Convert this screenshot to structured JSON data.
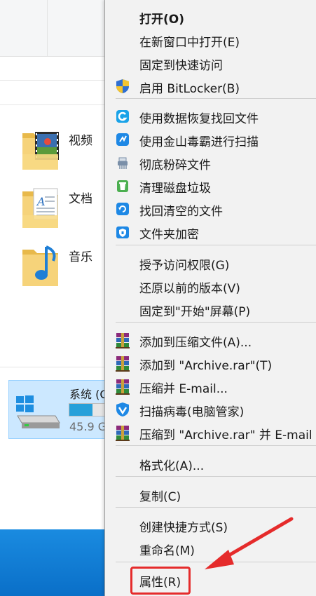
{
  "explorer": {
    "folders": [
      {
        "name": "视频",
        "icon": "video-folder-icon"
      },
      {
        "name": "文档",
        "icon": "documents-folder-icon"
      },
      {
        "name": "音乐",
        "icon": "music-folder-icon"
      }
    ],
    "drive": {
      "name": "系统 (C",
      "free_text": "45.9 G",
      "usage_fraction": 0.55
    }
  },
  "menu": {
    "items": [
      {
        "label": "打开(O)",
        "bold": true,
        "icon": ""
      },
      {
        "label": "在新窗口中打开(E)",
        "icon": ""
      },
      {
        "label": "固定到快速访问",
        "icon": ""
      },
      {
        "label": "启用 BitLocker(B)",
        "icon": "shield-icon"
      },
      {
        "label": "使用数据恢复找回文件",
        "icon": "data-recovery-icon"
      },
      {
        "label": "使用金山毒霸进行扫描",
        "icon": "antivirus-scan-icon"
      },
      {
        "label": "彻底粉碎文件",
        "icon": "shredder-icon"
      },
      {
        "label": "清理磁盘垃圾",
        "icon": "trash-clean-icon"
      },
      {
        "label": "找回清空的文件",
        "icon": "restore-icon"
      },
      {
        "label": "文件夹加密",
        "icon": "folder-lock-icon"
      },
      {
        "label": "授予访问权限(G)",
        "icon": ""
      },
      {
        "label": "还原以前的版本(V)",
        "icon": ""
      },
      {
        "label": "固定到\"开始\"屏幕(P)",
        "icon": ""
      },
      {
        "label": "添加到压缩文件(A)...",
        "icon": "winrar-icon"
      },
      {
        "label": "添加到 \"Archive.rar\"(T)",
        "icon": "winrar-icon"
      },
      {
        "label": "压缩并 E-mail...",
        "icon": "winrar-icon"
      },
      {
        "label": "扫描病毒(电脑管家)",
        "icon": "tencent-guard-icon"
      },
      {
        "label": "压缩到 \"Archive.rar\" 并 E-mail",
        "icon": "winrar-icon"
      },
      {
        "label": "格式化(A)...",
        "icon": ""
      },
      {
        "label": "复制(C)",
        "icon": ""
      },
      {
        "label": "创建快捷方式(S)",
        "icon": ""
      },
      {
        "label": "重命名(M)",
        "icon": ""
      },
      {
        "label": "属性(R)",
        "icon": ""
      }
    ]
  },
  "colors": {
    "highlight_box": "#e52b2b",
    "arrow": "#e52b2b",
    "drive_selection": "#cce8ff",
    "menu_bg": "#f2f2f2"
  }
}
